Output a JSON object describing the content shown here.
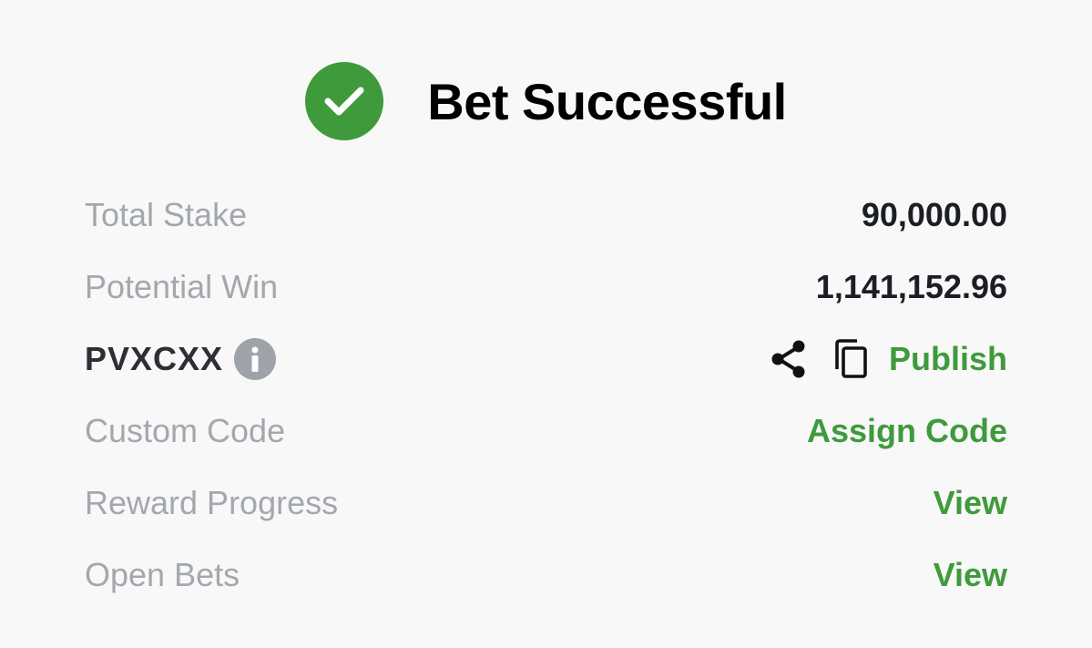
{
  "header": {
    "title": "Bet Successful",
    "icon": "check-circle-icon"
  },
  "rows": {
    "total_stake": {
      "label": "Total Stake",
      "value": "90,000.00"
    },
    "potential_win": {
      "label": "Potential Win",
      "value": "1,141,152.96"
    },
    "booking": {
      "code": "PVXCXX",
      "info_icon": "info-icon",
      "share_icon": "share-icon",
      "copy_icon": "copy-icon",
      "publish_label": "Publish"
    },
    "custom_code": {
      "label": "Custom Code",
      "action": "Assign Code"
    },
    "reward_progress": {
      "label": "Reward Progress",
      "action": "View"
    },
    "open_bets": {
      "label": "Open Bets",
      "action": "View"
    }
  },
  "colors": {
    "accent_green": "#3f9a3c",
    "label_gray": "#a3a7ae",
    "value_dark": "#1b1e24",
    "background": "#f8f8f8"
  }
}
